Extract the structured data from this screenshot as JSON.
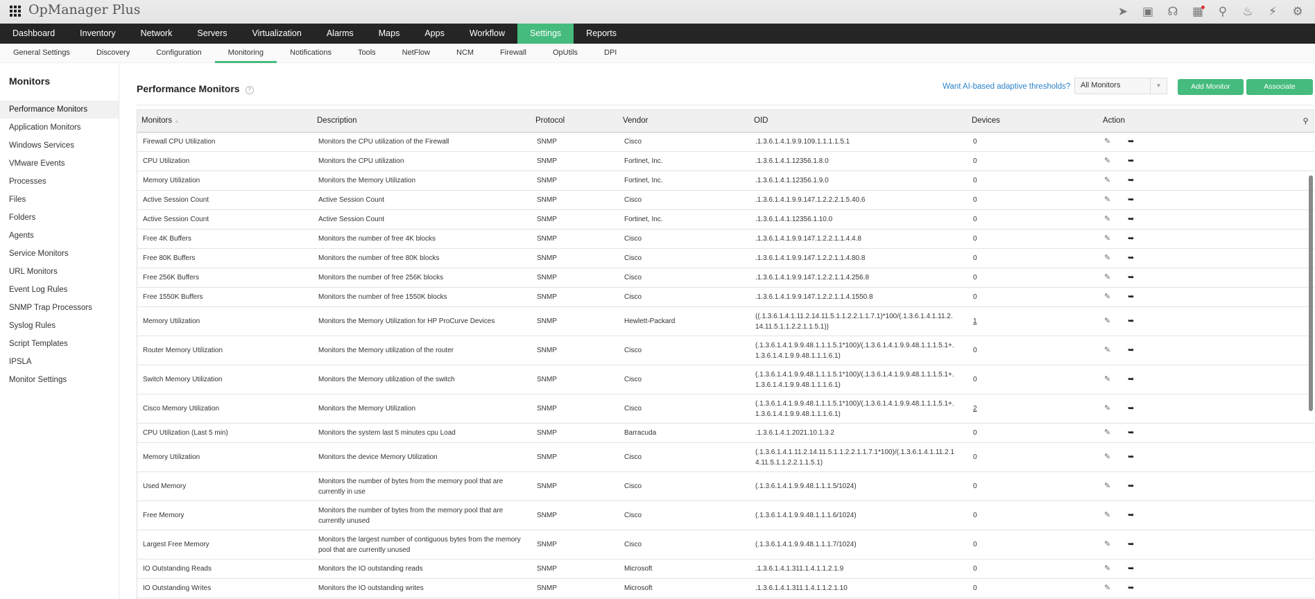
{
  "app": {
    "title": "OpManager Plus"
  },
  "top_icons": [
    "rocket-icon",
    "presentation-icon",
    "headset-icon",
    "gift-icon",
    "search-icon",
    "bell-icon",
    "plug-icon",
    "gear-icon"
  ],
  "main_nav": [
    {
      "label": "Dashboard"
    },
    {
      "label": "Inventory"
    },
    {
      "label": "Network"
    },
    {
      "label": "Servers"
    },
    {
      "label": "Virtualization"
    },
    {
      "label": "Alarms"
    },
    {
      "label": "Maps"
    },
    {
      "label": "Apps"
    },
    {
      "label": "Workflow"
    },
    {
      "label": "Settings",
      "active": true
    },
    {
      "label": "Reports"
    }
  ],
  "sub_nav": [
    {
      "label": "General Settings"
    },
    {
      "label": "Discovery"
    },
    {
      "label": "Configuration"
    },
    {
      "label": "Monitoring",
      "active": true
    },
    {
      "label": "Notifications"
    },
    {
      "label": "Tools"
    },
    {
      "label": "NetFlow"
    },
    {
      "label": "NCM"
    },
    {
      "label": "Firewall"
    },
    {
      "label": "OpUtils"
    },
    {
      "label": "DPI"
    }
  ],
  "sidebar": {
    "title": "Monitors",
    "items": [
      {
        "label": "Performance Monitors",
        "active": true
      },
      {
        "label": "Application Monitors"
      },
      {
        "label": "Windows Services"
      },
      {
        "label": "VMware Events"
      },
      {
        "label": "Processes"
      },
      {
        "label": "Files"
      },
      {
        "label": "Folders"
      },
      {
        "label": "Agents"
      },
      {
        "label": "Service Monitors"
      },
      {
        "label": "URL Monitors"
      },
      {
        "label": "Event Log Rules"
      },
      {
        "label": "SNMP Trap Processors"
      },
      {
        "label": "Syslog Rules"
      },
      {
        "label": "Script Templates"
      },
      {
        "label": "IPSLA"
      },
      {
        "label": "Monitor Settings"
      }
    ]
  },
  "main": {
    "title": "Performance Monitors",
    "help": "?",
    "ai_link": "Want AI-based adaptive thresholds?",
    "filter_select": "All Monitors",
    "add_monitor": "Add Monitor",
    "associate": "Associate"
  },
  "table": {
    "columns": [
      "Monitors",
      "Description",
      "Protocol",
      "Vendor",
      "OID",
      "Devices",
      "Action"
    ],
    "rows": [
      {
        "monitor": "Firewall CPU Utilization",
        "description": "Monitors the CPU utilization of the Firewall",
        "protocol": "SNMP",
        "vendor": "Cisco",
        "oid": ".1.3.6.1.4.1.9.9.109.1.1.1.1.5.1",
        "devices": "0",
        "link": false,
        "tall": false
      },
      {
        "monitor": "CPU Utilization",
        "description": "Monitors the CPU utilization",
        "protocol": "SNMP",
        "vendor": "Fortinet, Inc.",
        "oid": ".1.3.6.1.4.1.12356.1.8.0",
        "devices": "0",
        "link": false,
        "tall": false
      },
      {
        "monitor": "Memory Utilization",
        "description": "Monitors the Memory Utilization",
        "protocol": "SNMP",
        "vendor": "Fortinet, Inc.",
        "oid": ".1.3.6.1.4.1.12356.1.9.0",
        "devices": "0",
        "link": false,
        "tall": false
      },
      {
        "monitor": "Active Session Count",
        "description": "Active Session Count",
        "protocol": "SNMP",
        "vendor": "Cisco",
        "oid": ".1.3.6.1.4.1.9.9.147.1.2.2.2.1.5.40.6",
        "devices": "0",
        "link": false,
        "tall": false
      },
      {
        "monitor": "Active Session Count",
        "description": "Active Session Count",
        "protocol": "SNMP",
        "vendor": "Fortinet, Inc.",
        "oid": ".1.3.6.1.4.1.12356.1.10.0",
        "devices": "0",
        "link": false,
        "tall": false
      },
      {
        "monitor": "Free 4K Buffers",
        "description": "Monitors the number of free 4K blocks",
        "protocol": "SNMP",
        "vendor": "Cisco",
        "oid": ".1.3.6.1.4.1.9.9.147.1.2.2.1.1.4.4.8",
        "devices": "0",
        "link": false,
        "tall": false
      },
      {
        "monitor": "Free 80K Buffers",
        "description": "Monitors the number of free 80K blocks",
        "protocol": "SNMP",
        "vendor": "Cisco",
        "oid": ".1.3.6.1.4.1.9.9.147.1.2.2.1.1.4.80.8",
        "devices": "0",
        "link": false,
        "tall": false
      },
      {
        "monitor": "Free 256K Buffers",
        "description": "Monitors the number of free 256K blocks",
        "protocol": "SNMP",
        "vendor": "Cisco",
        "oid": ".1.3.6.1.4.1.9.9.147.1.2.2.1.1.4.256.8",
        "devices": "0",
        "link": false,
        "tall": false
      },
      {
        "monitor": "Free 1550K Buffers",
        "description": "Monitors the number of free 1550K blocks",
        "protocol": "SNMP",
        "vendor": "Cisco",
        "oid": ".1.3.6.1.4.1.9.9.147.1.2.2.1.1.4.1550.8",
        "devices": "0",
        "link": false,
        "tall": false
      },
      {
        "monitor": "Memory Utilization",
        "description": "Monitors the Memory Utilization for HP ProCurve Devices",
        "protocol": "SNMP",
        "vendor": "Hewlett-Packard",
        "oid": "((.1.3.6.1.4.1.11.2.14.11.5.1.1.2.2.1.1.7.1)*100/(.1.3.6.1.4.1.11.2.14.11.5.1.1.2.2.1.1.5.1))",
        "devices": "1",
        "link": true,
        "tall": true
      },
      {
        "monitor": "Router Memory Utilization",
        "description": "Monitors the Memory utilization of the router",
        "protocol": "SNMP",
        "vendor": "Cisco",
        "oid": "(.1.3.6.1.4.1.9.9.48.1.1.1.5.1*100)/(.1.3.6.1.4.1.9.9.48.1.1.1.5.1+.1.3.6.1.4.1.9.9.48.1.1.1.6.1)",
        "devices": "0",
        "link": false,
        "tall": true
      },
      {
        "monitor": "Switch Memory Utilization",
        "description": "Monitors the Memory utilization of the switch",
        "protocol": "SNMP",
        "vendor": "Cisco",
        "oid": "(.1.3.6.1.4.1.9.9.48.1.1.1.5.1*100)/(.1.3.6.1.4.1.9.9.48.1.1.1.5.1+.1.3.6.1.4.1.9.9.48.1.1.1.6.1)",
        "devices": "0",
        "link": false,
        "tall": true
      },
      {
        "monitor": "Cisco Memory Utilization",
        "description": "Monitors the Memory Utilization",
        "protocol": "SNMP",
        "vendor": "Cisco",
        "oid": "(.1.3.6.1.4.1.9.9.48.1.1.1.5.1*100)/(.1.3.6.1.4.1.9.9.48.1.1.1.5.1+.1.3.6.1.4.1.9.9.48.1.1.1.6.1)",
        "devices": "2",
        "link": true,
        "tall": true
      },
      {
        "monitor": "CPU Utilization (Last 5 min)",
        "description": "Monitors the system last 5 minutes cpu Load",
        "protocol": "SNMP",
        "vendor": "Barracuda",
        "oid": ".1.3.6.1.4.1.2021.10.1.3.2",
        "devices": "0",
        "link": false,
        "tall": false
      },
      {
        "monitor": "Memory Utilization",
        "description": "Monitors the device Memory Utilization",
        "protocol": "SNMP",
        "vendor": "Cisco",
        "oid": "(.1.3.6.1.4.1.11.2.14.11.5.1.1.2.2.1.1.7.1*100)/(.1.3.6.1.4.1.11.2.14.11.5.1.1.2.2.1.1.5.1)",
        "devices": "0",
        "link": false,
        "tall": true
      },
      {
        "monitor": "Used Memory",
        "description": "Monitors the number of bytes from the memory pool that are currently in use",
        "protocol": "SNMP",
        "vendor": "Cisco",
        "oid": "(.1.3.6.1.4.1.9.9.48.1.1.1.5/1024)",
        "devices": "0",
        "link": false,
        "tall": true
      },
      {
        "monitor": "Free Memory",
        "description": "Monitors the number of bytes from the memory pool that are currently unused",
        "protocol": "SNMP",
        "vendor": "Cisco",
        "oid": "(.1.3.6.1.4.1.9.9.48.1.1.1.6/1024)",
        "devices": "0",
        "link": false,
        "tall": true
      },
      {
        "monitor": "Largest Free Memory",
        "description": "Monitors the largest number of contiguous bytes from the memory pool that are currently unused",
        "protocol": "SNMP",
        "vendor": "Cisco",
        "oid": "(.1.3.6.1.4.1.9.9.48.1.1.1.7/1024)",
        "devices": "0",
        "link": false,
        "tall": true
      },
      {
        "monitor": "IO Outstanding Reads",
        "description": "Monitors the IO outstanding reads",
        "protocol": "SNMP",
        "vendor": "Microsoft",
        "oid": ".1.3.6.1.4.1.311.1.4.1.1.2.1.9",
        "devices": "0",
        "link": false,
        "tall": false
      },
      {
        "monitor": "IO Outstanding Writes",
        "description": "Monitors the IO outstanding writes",
        "protocol": "SNMP",
        "vendor": "Microsoft",
        "oid": ".1.3.6.1.4.1.311.1.4.1.1.2.1.10",
        "devices": "0",
        "link": false,
        "tall": false
      }
    ]
  },
  "colors": {
    "accent": "#45bb7d",
    "nav_bg": "#252525",
    "link": "#2d83c9"
  }
}
